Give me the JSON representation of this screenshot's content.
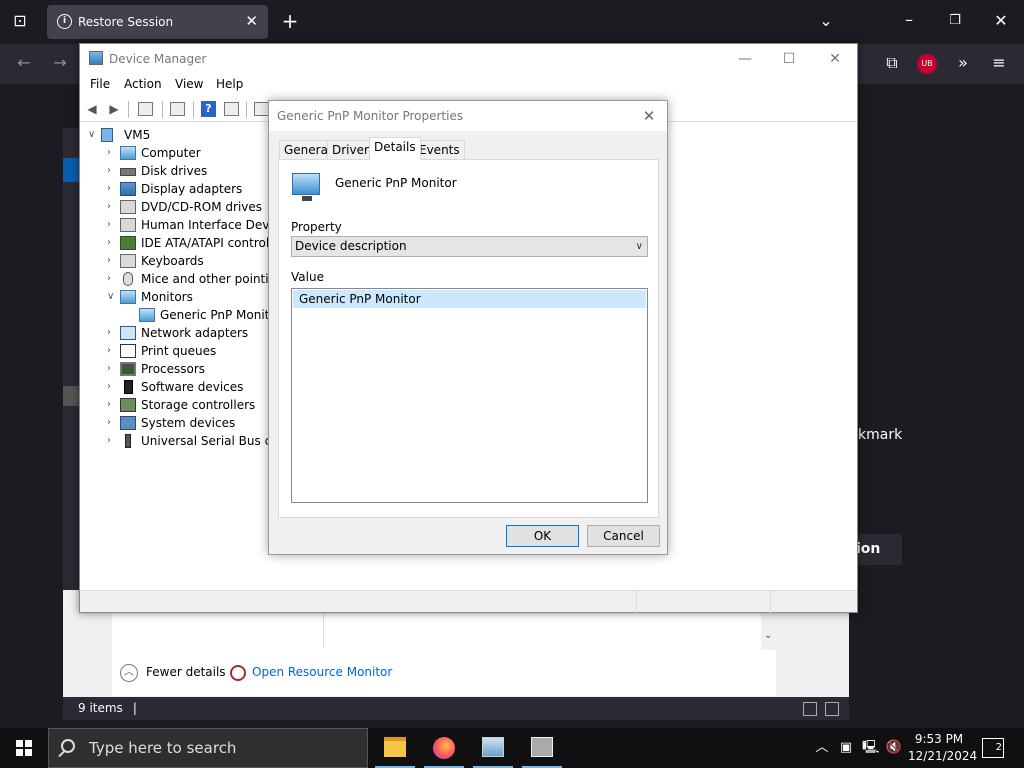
{
  "browser": {
    "tab_title": "Restore Session",
    "side_text": "kmark",
    "side_button": "ion"
  },
  "task_manager": {
    "fewer_details": "Fewer details",
    "open_resource_monitor": "Open Resource Monitor",
    "status_items": "9 items"
  },
  "device_manager": {
    "title": "Device Manager",
    "menu": [
      "File",
      "Action",
      "View",
      "Help"
    ],
    "tree": {
      "root": "VM5",
      "items": [
        {
          "label": "Computer",
          "icon": "computer-icon"
        },
        {
          "label": "Disk drives",
          "icon": "disk-drive-icon"
        },
        {
          "label": "Display adapters",
          "icon": "display-adapter-icon"
        },
        {
          "label": "DVD/CD-ROM drives",
          "icon": "dvd-drive-icon"
        },
        {
          "label": "Human Interface Devices",
          "icon": "hid-icon"
        },
        {
          "label": "IDE ATA/ATAPI controllers",
          "icon": "ide-controller-icon"
        },
        {
          "label": "Keyboards",
          "icon": "keyboard-icon"
        },
        {
          "label": "Mice and other pointing devices",
          "icon": "mouse-icon"
        },
        {
          "label": "Monitors",
          "icon": "monitor-icon",
          "expanded": true
        },
        {
          "label": "Generic PnP Monitor",
          "icon": "monitor-icon",
          "child": true
        },
        {
          "label": "Network adapters",
          "icon": "network-adapter-icon"
        },
        {
          "label": "Print queues",
          "icon": "printer-icon"
        },
        {
          "label": "Processors",
          "icon": "processor-icon"
        },
        {
          "label": "Software devices",
          "icon": "software-device-icon"
        },
        {
          "label": "Storage controllers",
          "icon": "storage-controller-icon"
        },
        {
          "label": "System devices",
          "icon": "system-device-icon"
        },
        {
          "label": "Universal Serial Bus controllers",
          "icon": "usb-icon"
        }
      ]
    }
  },
  "dialog": {
    "title": "Generic PnP Monitor Properties",
    "tabs": [
      "General",
      "Driver",
      "Details",
      "Events"
    ],
    "active_tab": "Details",
    "device_name": "Generic PnP Monitor",
    "property_label": "Property",
    "property_value": "Device description",
    "value_label": "Value",
    "values": [
      "Generic PnP Monitor"
    ],
    "ok": "OK",
    "cancel": "Cancel"
  },
  "taskbar": {
    "search_placeholder": "Type here to search",
    "time": "9:53 PM",
    "date": "12/21/2024",
    "notification_count": "2"
  }
}
